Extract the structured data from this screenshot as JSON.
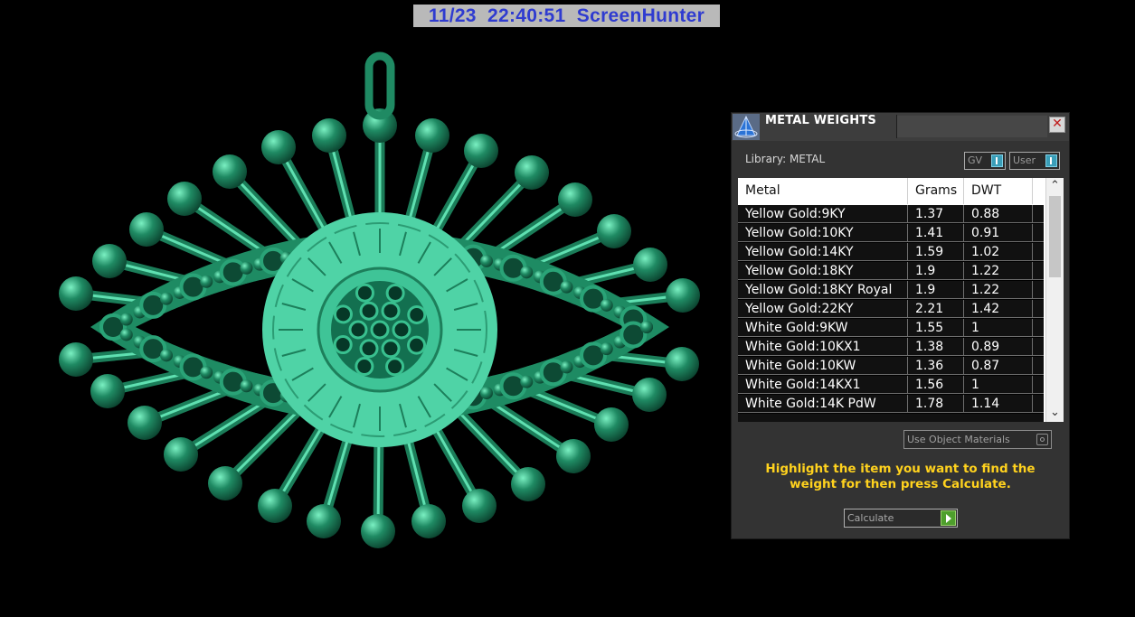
{
  "stamp": {
    "text": "11/23  22:40:51  ScreenHunter"
  },
  "colors": {
    "model": "#1f8a63",
    "model_light": "#4fd3a6",
    "accent": "#ffd21e",
    "titlebar": "#3d3d3d"
  },
  "dialog": {
    "title": "METAL WEIGHTS",
    "close_icon": "close-icon",
    "library_label": "Library: METAL",
    "gv_label": "GV",
    "user_label": "User",
    "columns": [
      "Metal",
      "Grams",
      "DWT"
    ],
    "rows": [
      {
        "metal": "Yellow Gold:9KY",
        "grams": "1.37",
        "dwt": "0.88"
      },
      {
        "metal": "Yellow Gold:10KY",
        "grams": "1.41",
        "dwt": "0.91"
      },
      {
        "metal": "Yellow Gold:14KY",
        "grams": "1.59",
        "dwt": "1.02"
      },
      {
        "metal": "Yellow Gold:18KY",
        "grams": "1.9",
        "dwt": "1.22"
      },
      {
        "metal": "Yellow Gold:18KY Royal",
        "grams": "1.9",
        "dwt": "1.22"
      },
      {
        "metal": "Yellow Gold:22KY",
        "grams": "2.21",
        "dwt": "1.42"
      },
      {
        "metal": "White Gold:9KW",
        "grams": "1.55",
        "dwt": "1"
      },
      {
        "metal": "White Gold:10KX1",
        "grams": "1.38",
        "dwt": "0.89"
      },
      {
        "metal": "White Gold:10KW",
        "grams": "1.36",
        "dwt": "0.87"
      },
      {
        "metal": "White Gold:14KX1",
        "grams": "1.56",
        "dwt": "1"
      },
      {
        "metal": "White Gold:14K PdW",
        "grams": "1.78",
        "dwt": "1.14"
      }
    ],
    "use_object_materials": "Use Object Materials",
    "hint": "Highlight the item you want to find the weight for then press Calculate.",
    "calculate_label": "Calculate"
  }
}
